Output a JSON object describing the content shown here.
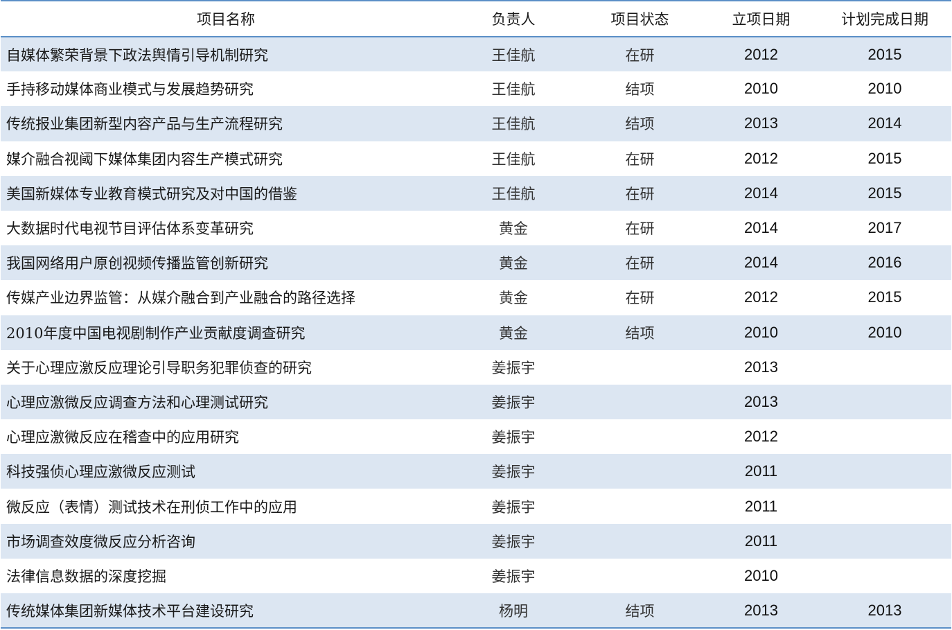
{
  "table": {
    "headers": {
      "name": "项目名称",
      "owner": "负责人",
      "status": "项目状态",
      "start": "立项日期",
      "end": "计划完成日期"
    },
    "rows": [
      {
        "name": "自媒体繁荣背景下政法舆情引导机制研究",
        "owner": "王佳航",
        "status": "在研",
        "start": "2012",
        "end": "2015"
      },
      {
        "name": "手持移动媒体商业模式与发展趋势研究",
        "owner": "王佳航",
        "status": "结项",
        "start": "2010",
        "end": "2010"
      },
      {
        "name": "传统报业集团新型内容产品与生产流程研究",
        "owner": "王佳航",
        "status": "结项",
        "start": "2013",
        "end": "2014"
      },
      {
        "name": "媒介融合视阈下媒体集团内容生产模式研究",
        "owner": "王佳航",
        "status": "在研",
        "start": "2012",
        "end": "2015"
      },
      {
        "name": "美国新媒体专业教育模式研究及对中国的借鉴",
        "owner": "王佳航",
        "status": "在研",
        "start": "2014",
        "end": "2015"
      },
      {
        "name": "大数据时代电视节目评估体系变革研究",
        "owner": "黄金",
        "status": "在研",
        "start": "2014",
        "end": "2017"
      },
      {
        "name": "我国网络用户原创视频传播监管创新研究",
        "owner": "黄金",
        "status": "在研",
        "start": "2014",
        "end": "2016"
      },
      {
        "name": "传媒产业边界监管：从媒介融合到产业融合的路径选择",
        "owner": "黄金",
        "status": "在研",
        "start": "2012",
        "end": "2015"
      },
      {
        "name": "2010年度中国电视剧制作产业贡献度调查研究",
        "owner": "黄金",
        "status": "结项",
        "start": "2010",
        "end": "2010"
      },
      {
        "name": "关于心理应激反应理论引导职务犯罪侦查的研究",
        "owner": "姜振宇",
        "status": "",
        "start": "2013",
        "end": ""
      },
      {
        "name": "心理应激微反应调查方法和心理测试研究",
        "owner": "姜振宇",
        "status": "",
        "start": "2013",
        "end": ""
      },
      {
        "name": "心理应激微反应在稽查中的应用研究",
        "owner": "姜振宇",
        "status": "",
        "start": "2012",
        "end": ""
      },
      {
        "name": "科技强侦心理应激微反应测试",
        "owner": "姜振宇",
        "status": "",
        "start": "2011",
        "end": ""
      },
      {
        "name": "微反应（表情）测试技术在刑侦工作中的应用",
        "owner": "姜振宇",
        "status": "",
        "start": "2011",
        "end": ""
      },
      {
        "name": "市场调查效度微反应分析咨询",
        "owner": "姜振宇",
        "status": "",
        "start": "2011",
        "end": ""
      },
      {
        "name": "法律信息数据的深度挖掘",
        "owner": "姜振宇",
        "status": "",
        "start": "2010",
        "end": ""
      },
      {
        "name": "传统媒体集团新媒体技术平台建设研究",
        "owner": "杨明",
        "status": "结项",
        "start": "2013",
        "end": "2013"
      }
    ]
  },
  "colors": {
    "rule": "#5b8fc7",
    "band": "#dce6f2"
  }
}
